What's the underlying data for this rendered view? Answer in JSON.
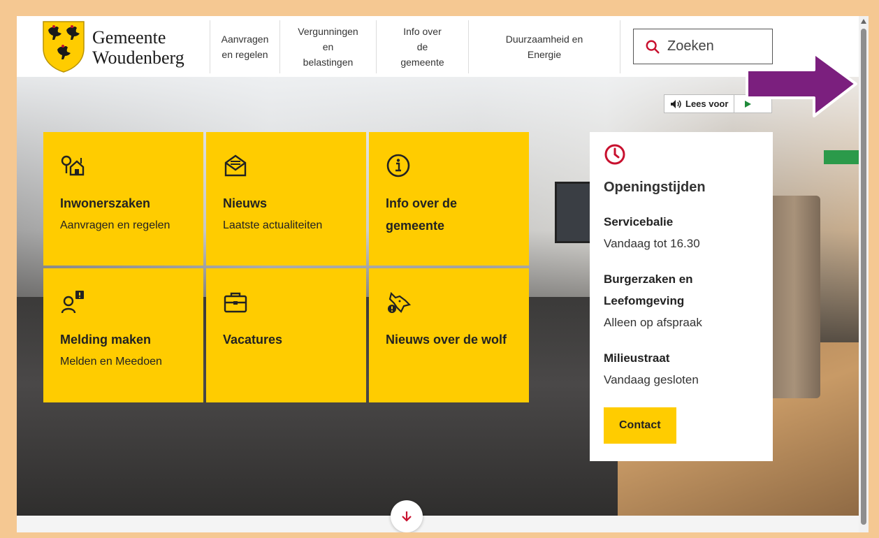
{
  "header": {
    "logo_line1": "Gemeente",
    "logo_line2": "Woudenberg",
    "nav": [
      {
        "lines": [
          "Aanvragen",
          "en regelen"
        ]
      },
      {
        "lines": [
          "Vergunningen",
          "en",
          "belastingen"
        ]
      },
      {
        "lines": [
          "Info over",
          "de",
          "gemeente"
        ]
      },
      {
        "lines": [
          "Duurzaamheid en",
          "Energie"
        ]
      }
    ],
    "search_label": "Zoeken"
  },
  "read_aloud": {
    "label": "Lees voor"
  },
  "tiles": [
    {
      "title": "Inwonerszaken",
      "subtitle": "Aanvragen en regelen",
      "icon": "house-tree-icon"
    },
    {
      "title": "Nieuws",
      "subtitle": "Laatste actualiteiten",
      "icon": "newsletter-icon"
    },
    {
      "title": "Info over de gemeente",
      "subtitle": "",
      "icon": "info-icon"
    },
    {
      "title": "Melding maken",
      "subtitle": "Melden en Meedoen",
      "icon": "person-alert-icon"
    },
    {
      "title": "Vacatures",
      "subtitle": "",
      "icon": "briefcase-icon"
    },
    {
      "title": "Nieuws over de wolf",
      "subtitle": "",
      "icon": "wolf-alert-icon"
    }
  ],
  "hours": {
    "title": "Openingstijden",
    "groups": [
      {
        "heading": "Servicebalie",
        "value": "Vandaag tot 16.30"
      },
      {
        "heading": "Burgerzaken en Leefomgeving",
        "value": "Alleen op afspraak"
      },
      {
        "heading": "Milieustraat",
        "value": "Vandaag gesloten"
      }
    ],
    "contact_label": "Contact"
  },
  "colors": {
    "accent_yellow": "#ffcc00",
    "accent_red": "#c8102e",
    "frame_bg": "#f5c892",
    "annotation_arrow": "#7b1f7e"
  }
}
